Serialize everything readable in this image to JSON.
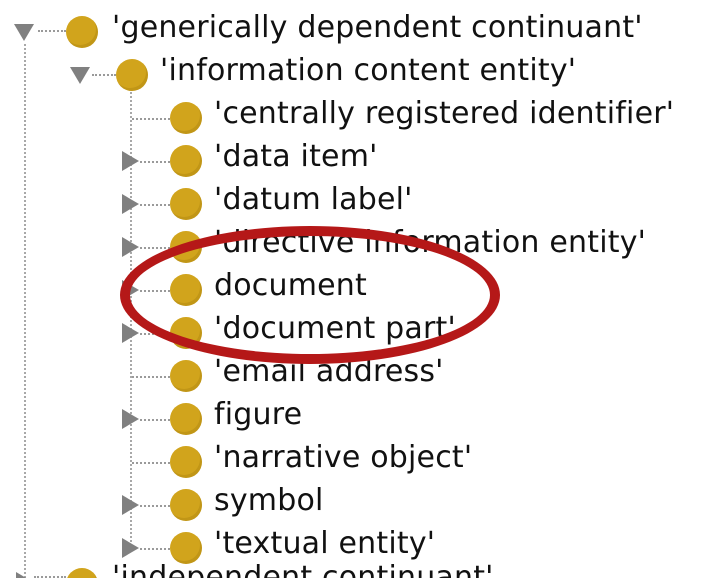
{
  "tree": {
    "root": {
      "label": "'generically dependent continuant'",
      "expanded": true,
      "icon": "class-icon-gold"
    },
    "parent": {
      "label": "'information content entity'",
      "expanded": true,
      "icon": "class-icon-gold"
    },
    "children": [
      {
        "label": "'centrally registered identifier'",
        "expandable": false
      },
      {
        "label": "'data item'",
        "expandable": true
      },
      {
        "label": "'datum label'",
        "expandable": true
      },
      {
        "label": "'directive information entity'",
        "expandable": true
      },
      {
        "label": "document",
        "expandable": true
      },
      {
        "label": "'document part'",
        "expandable": true
      },
      {
        "label": "'email address'",
        "expandable": false
      },
      {
        "label": "figure",
        "expandable": true
      },
      {
        "label": "'narrative object'",
        "expandable": false
      },
      {
        "label": "symbol",
        "expandable": true
      },
      {
        "label": "'textual entity'",
        "expandable": true
      }
    ],
    "next_sibling": {
      "label": "'independent continuant'",
      "partially_visible": true
    }
  },
  "annotation": {
    "shape": "ellipse",
    "color": "#b51818",
    "highlights": "document"
  },
  "colors": {
    "class_icon": "#d1a41c",
    "expander": "#808080",
    "connector": "#9a9a9a"
  }
}
